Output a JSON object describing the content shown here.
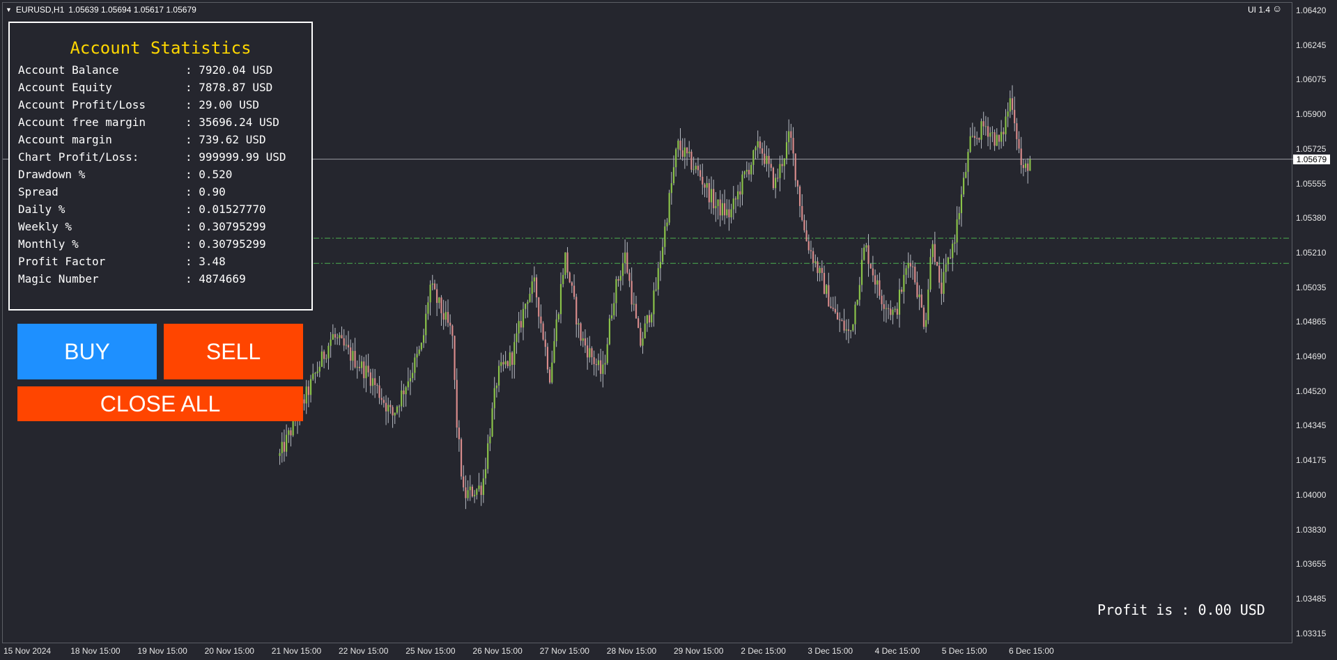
{
  "header": {
    "symbol": "EURUSD,H1",
    "ohlc": "1.05639 1.05694 1.05617 1.05679",
    "ui_label": "UI 1.4"
  },
  "price_axis": {
    "ticks": [
      "1.06420",
      "1.06245",
      "1.06075",
      "1.05900",
      "1.05725",
      "1.05555",
      "1.05380",
      "1.05210",
      "1.05035",
      "1.04865",
      "1.04690",
      "1.04520",
      "1.04345",
      "1.04175",
      "1.04000",
      "1.03830",
      "1.03655",
      "1.03485",
      "1.03315"
    ],
    "current_price": "1.05679"
  },
  "time_axis": {
    "labels": [
      "15 Nov 2024",
      "18 Nov 15:00",
      "19 Nov 15:00",
      "20 Nov 15:00",
      "21 Nov 15:00",
      "22 Nov 15:00",
      "25 Nov 15:00",
      "26 Nov 15:00",
      "27 Nov 15:00",
      "28 Nov 15:00",
      "29 Nov 15:00",
      "2 Dec 15:00",
      "3 Dec 15:00",
      "4 Dec 15:00",
      "5 Dec 15:00",
      "6 Dec 15:00"
    ]
  },
  "stats": {
    "title": "Account Statistics",
    "rows": [
      {
        "label": "Account Balance",
        "value": ": 7920.04 USD"
      },
      {
        "label": "Account Equity",
        "value": ": 7878.87 USD"
      },
      {
        "label": "Account Profit/Loss",
        "value": ": 29.00 USD"
      },
      {
        "label": "Account free margin",
        "value": ": 35696.24 USD"
      },
      {
        "label": "Account margin",
        "value": ": 739.62 USD"
      },
      {
        "label": "Chart Profit/Loss:",
        "value": ": 999999.99 USD"
      },
      {
        "label": "Drawdown %",
        "value": ": 0.520"
      },
      {
        "label": "Spread",
        "value": ": 0.90"
      },
      {
        "label": "Daily %",
        "value": ": 0.01527770"
      },
      {
        "label": "Weekly %",
        "value": ": 0.30795299"
      },
      {
        "label": "Monthly %",
        "value": ": 0.30795299"
      },
      {
        "label": "Profit Factor",
        "value": ": 3.48"
      },
      {
        "label": "Magic Number",
        "value": ": 4874669"
      }
    ]
  },
  "buttons": {
    "buy": "BUY",
    "sell": "SELL",
    "close_all": "CLOSE ALL"
  },
  "profit_text": "Profit is : 0.00 USD",
  "colors": {
    "background": "#25262e",
    "bull": "#8bc34a",
    "bear": "#d98c8c",
    "level_line": "#4caf50",
    "buy": "#1e90ff",
    "sell": "#ff4500",
    "title": "#ffd700"
  },
  "price_levels": [
    1.05285,
    1.0516
  ],
  "chart_series": {
    "anchors": [
      [
        1.042,
        0
      ],
      [
        1.048,
        0.07
      ],
      [
        1.046,
        0.12
      ],
      [
        1.044,
        0.15
      ],
      [
        1.0475,
        0.19
      ],
      [
        1.0505,
        0.2
      ],
      [
        1.048,
        0.23
      ],
      [
        1.044,
        0.235
      ],
      [
        1.04,
        0.245
      ],
      [
        1.0405,
        0.27
      ],
      [
        1.046,
        0.29
      ],
      [
        1.047,
        0.31
      ],
      [
        1.05,
        0.33
      ],
      [
        1.0505,
        0.34
      ],
      [
        1.046,
        0.36
      ],
      [
        1.052,
        0.38
      ],
      [
        1.048,
        0.4
      ],
      [
        1.046,
        0.43
      ],
      [
        1.05,
        0.445
      ],
      [
        1.052,
        0.46
      ],
      [
        1.0475,
        0.48
      ],
      [
        1.05,
        0.5
      ],
      [
        1.055,
        0.52
      ],
      [
        1.0575,
        0.53
      ],
      [
        1.056,
        0.56
      ],
      [
        1.0545,
        0.58
      ],
      [
        1.054,
        0.6
      ],
      [
        1.056,
        0.62
      ],
      [
        1.0575,
        0.64
      ],
      [
        1.0555,
        0.66
      ],
      [
        1.058,
        0.68
      ],
      [
        1.053,
        0.7
      ],
      [
        1.051,
        0.72
      ],
      [
        1.049,
        0.74
      ],
      [
        1.048,
        0.76
      ],
      [
        1.0525,
        0.78
      ],
      [
        1.05,
        0.8
      ],
      [
        1.049,
        0.82
      ],
      [
        1.052,
        0.84
      ],
      [
        1.0485,
        0.86
      ],
      [
        1.053,
        0.87
      ],
      [
        1.05,
        0.88
      ],
      [
        1.053,
        0.9
      ],
      [
        1.0575,
        0.92
      ],
      [
        1.0585,
        0.94
      ],
      [
        1.0575,
        0.96
      ],
      [
        1.06,
        0.975
      ],
      [
        1.056,
        0.99
      ],
      [
        1.05679,
        1.0
      ]
    ],
    "candle_count": 340
  }
}
